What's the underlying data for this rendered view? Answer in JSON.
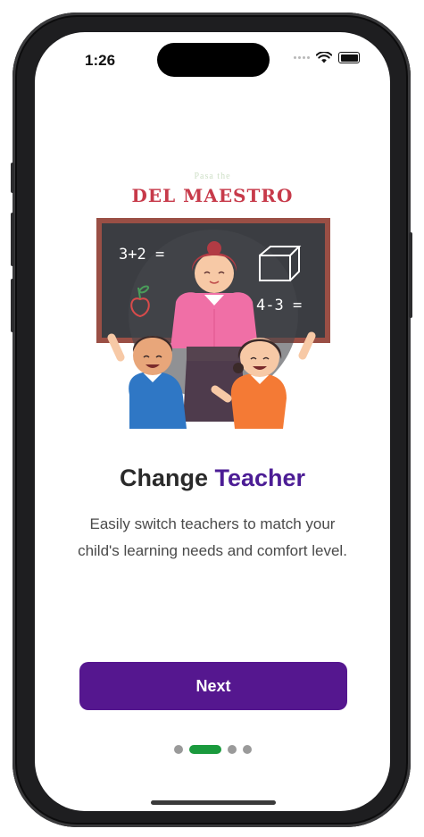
{
  "status_bar": {
    "time": "1:26"
  },
  "logo": {
    "small_text": "Pasa the",
    "brand": "DEL MAESTRO"
  },
  "illustration": {
    "board_left": "3+2 =",
    "board_right": "4-3 ="
  },
  "content": {
    "title_prefix": "Change",
    "title_accent": "Teacher",
    "description": "Easily switch teachers to match your child's learning needs and comfort level."
  },
  "next_button": {
    "label": "Next"
  },
  "pagination": {
    "total": 4,
    "active_index": 1
  },
  "colors": {
    "accent": "#4c1d95",
    "button": "#55178f",
    "active_dot": "#1a9a3d",
    "brand_red": "#c73a4a"
  }
}
